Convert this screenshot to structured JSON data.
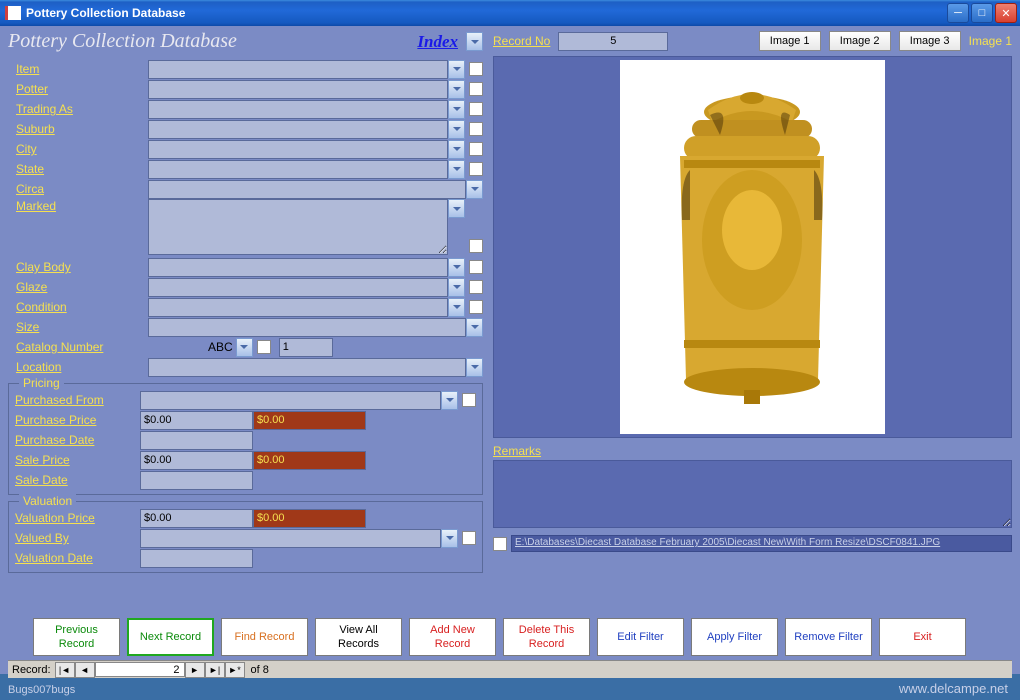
{
  "window": {
    "title": "Pottery Collection Database"
  },
  "header": {
    "app_title": "Pottery Collection Database",
    "index_label": "Index"
  },
  "fields": {
    "item": "Item",
    "potter": "Potter",
    "trading_as": "Trading As",
    "suburb": "Suburb",
    "city": "City",
    "state": "State",
    "circa": "Circa",
    "marked": "Marked",
    "clay_body": "Clay Body",
    "glaze": "Glaze",
    "condition": "Condition",
    "size": "Size",
    "catalog_number": "Catalog Number",
    "location": "Location"
  },
  "catalog": {
    "abc": "ABC",
    "num": "1"
  },
  "pricing": {
    "legend": "Pricing",
    "purchased_from": "Purchased From",
    "purchase_price": "Purchase Price",
    "purchase_price_val": "$0.00",
    "purchase_price_hl": "$0.00",
    "purchase_date": "Purchase Date",
    "sale_price": "Sale Price",
    "sale_price_val": "$0.00",
    "sale_price_hl": "$0.00",
    "sale_date": "Sale Date"
  },
  "valuation": {
    "legend": "Valuation",
    "valuation_price": "Valuation Price",
    "valuation_price_val": "$0.00",
    "valuation_price_hl": "$0.00",
    "valued_by": "Valued By",
    "valuation_date": "Valuation Date"
  },
  "right": {
    "record_no_label": "Record No",
    "record_no": "5",
    "image1": "Image 1",
    "image2": "Image 2",
    "image3": "Image 3",
    "current_image": "Image 1",
    "remarks_label": "Remarks",
    "path": "E:\\Databases\\Diecast Database February 2005\\Diecast New\\With Form Resize\\DSCF0841.JPG"
  },
  "buttons": {
    "previous": "Previous Record",
    "next": "Next Record",
    "find": "Find Record",
    "view_all": "View All Records",
    "add_new": "Add New Record",
    "delete": "Delete This Record",
    "edit_filter": "Edit Filter",
    "apply_filter": "Apply Filter",
    "remove_filter": "Remove Filter",
    "exit": "Exit"
  },
  "nav": {
    "label": "Record:",
    "current": "2",
    "total": "of  8"
  },
  "footer": {
    "left": "Bugs007bugs",
    "watermark": "www.delcampe.net"
  }
}
